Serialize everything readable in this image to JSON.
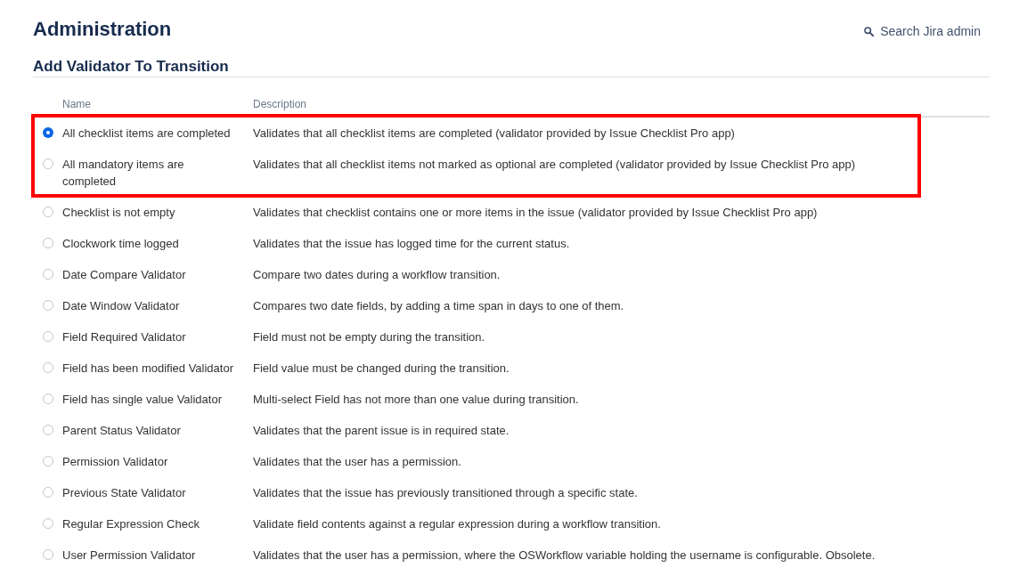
{
  "page": {
    "title": "Administration",
    "search_link": "Search Jira admin"
  },
  "section_title": "Add Validator To Transition",
  "table": {
    "columns": [
      "Name",
      "Description"
    ],
    "rows": [
      {
        "name": "All checklist items are completed",
        "description": "Validates that all checklist items are completed (validator provided by Issue Checklist Pro app)",
        "selected": true,
        "highlighted": true
      },
      {
        "name": "All mandatory items are completed",
        "description": "Validates that all checklist items not marked as optional are completed (validator provided by Issue Checklist Pro app)",
        "selected": false,
        "highlighted": true
      },
      {
        "name": "Checklist is not empty",
        "description": "Validates that checklist contains one or more items in the issue (validator provided by Issue Checklist Pro app)",
        "selected": false,
        "highlighted": false
      },
      {
        "name": "Clockwork time logged",
        "description": "Validates that the issue has logged time for the current status.",
        "selected": false,
        "highlighted": false
      },
      {
        "name": "Date Compare Validator",
        "description": "Compare two dates during a workflow transition.",
        "selected": false,
        "highlighted": false
      },
      {
        "name": "Date Window Validator",
        "description": "Compares two date fields, by adding a time span in days to one of them.",
        "selected": false,
        "highlighted": false
      },
      {
        "name": "Field Required Validator",
        "description": "Field must not be empty during the transition.",
        "selected": false,
        "highlighted": false
      },
      {
        "name": "Field has been modified Validator",
        "description": "Field value must be changed during the transition.",
        "selected": false,
        "highlighted": false
      },
      {
        "name": "Field has single value Validator",
        "description": "Multi-select Field has not more than one value during transition.",
        "selected": false,
        "highlighted": false
      },
      {
        "name": "Parent Status Validator",
        "description": "Validates that the parent issue is in required state.",
        "selected": false,
        "highlighted": false
      },
      {
        "name": "Permission Validator",
        "description": "Validates that the user has a permission.",
        "selected": false,
        "highlighted": false
      },
      {
        "name": "Previous State Validator",
        "description": "Validates that the issue has previously transitioned through a specific state.",
        "selected": false,
        "highlighted": false
      },
      {
        "name": "Regular Expression Check",
        "description": "Validate field contents against a regular expression during a workflow transition.",
        "selected": false,
        "highlighted": false
      },
      {
        "name": "User Permission Validator",
        "description": "Validates that the user has a permission, where the OSWorkflow variable holding the username is configurable. Obsolete.",
        "selected": false,
        "highlighted": false
      }
    ]
  }
}
